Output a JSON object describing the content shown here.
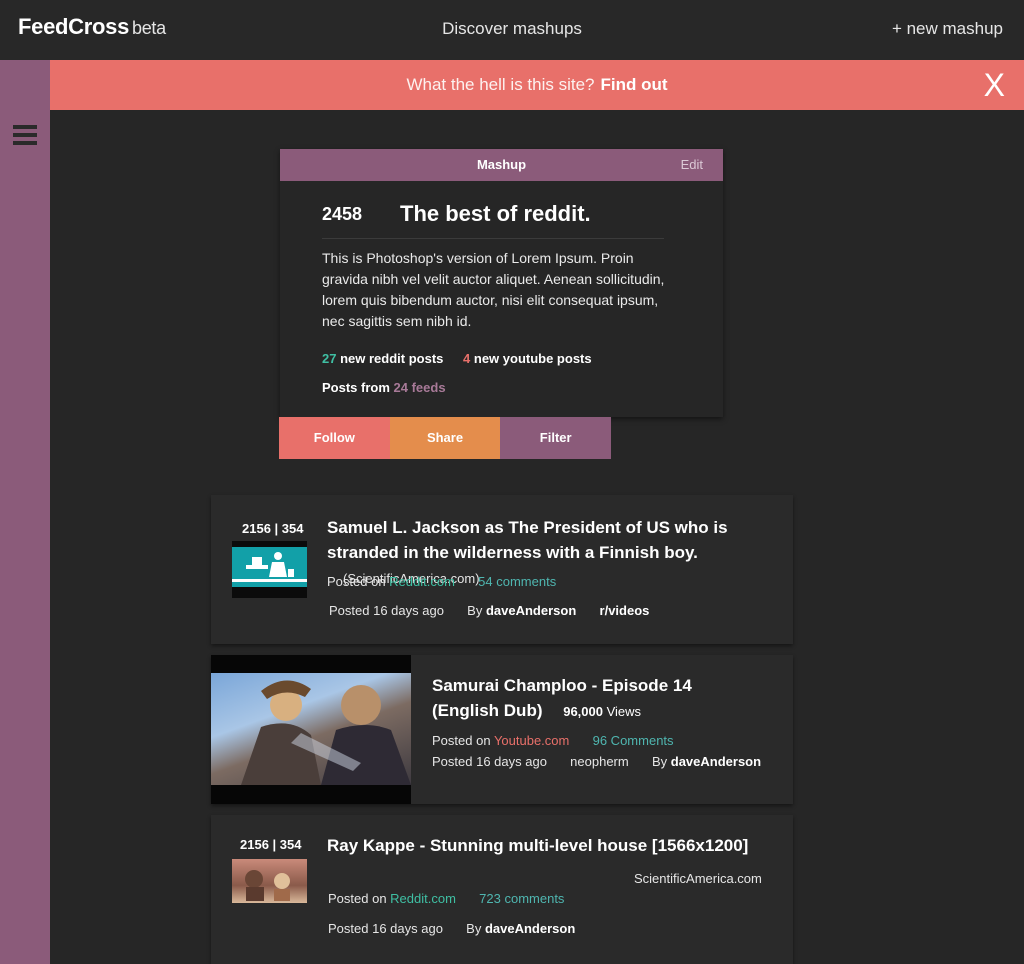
{
  "header": {
    "brand": "FeedCross",
    "beta": "beta",
    "discover": "Discover mashups",
    "new_mashup": "+ new mashup"
  },
  "banner": {
    "question": "What the hell is this site?",
    "link": "Find out",
    "close": "X"
  },
  "mashup": {
    "header_label": "Mashup",
    "edit": "Edit",
    "score": "2458",
    "title": "The best of reddit.",
    "description": "This is Photoshop's version  of Lorem Ipsum. Proin gravida nibh vel velit auctor aliquet. Aenean sollicitudin, lorem quis bibendum auctor, nisi elit consequat ipsum, nec sagittis sem nibh id.",
    "reddit_count": "27",
    "reddit_label": "new reddit posts",
    "youtube_count": "4",
    "youtube_label": "new youtube posts",
    "posts_from": "Posts from",
    "feeds": "24 feeds"
  },
  "actions": {
    "follow": "Follow",
    "share": "Share",
    "filter": "Filter"
  },
  "posts": [
    {
      "votes": "2156 | 354",
      "title": "Samuel L. Jackson as The President of US who is stranded in the wilderness with a Finnish boy.",
      "source": "(ScientificAmerica.com)",
      "posted_on": "Posted on",
      "site": "Reddit.com",
      "comments": "54 comments",
      "posted_ago": "Posted 16 days ago",
      "by": "By",
      "author": "daveAnderson",
      "sub": "r/videos"
    },
    {
      "title_line1": "Samurai Champloo - Episode 14",
      "title_line2": "(English Dub)",
      "views": "96,000",
      "views_label": "Views",
      "posted_on": "Posted on",
      "site": "Youtube.com",
      "comments": "96 Comments",
      "posted_ago": "Posted 16 days ago",
      "channel": "neopherm",
      "by": "By",
      "author": "daveAnderson"
    },
    {
      "votes": "2156 | 354",
      "title": "Ray Kappe - Stunning multi-level house [1566x1200]",
      "source": "ScientificAmerica.com",
      "posted_on": "Posted on",
      "site": "Reddit.com",
      "comments": "723 comments",
      "posted_ago": "Posted 16 days ago",
      "by": "By",
      "author": "daveAnderson"
    }
  ],
  "icons": {
    "menu": "hamburger-menu-icon",
    "close": "close-icon"
  },
  "colors": {
    "accent_red": "#e8706a",
    "accent_orange": "#e48d4c",
    "accent_purple": "#8b5b7a",
    "accent_teal": "#3fbfa3",
    "background": "#262626"
  }
}
